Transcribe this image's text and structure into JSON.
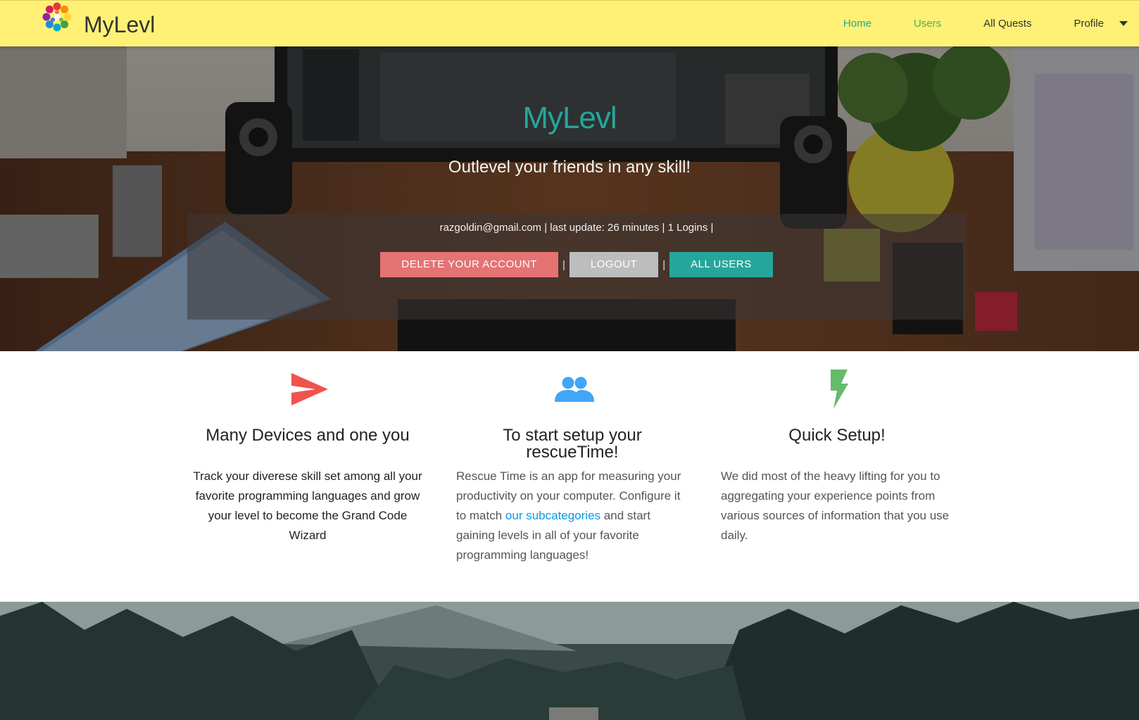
{
  "navbar": {
    "brand": "MyLevl",
    "links": [
      {
        "label": "Home"
      },
      {
        "label": "Users"
      },
      {
        "label": "All Quests"
      },
      {
        "label": "Profile"
      }
    ],
    "bg_color": "#fff176"
  },
  "hero": {
    "title": "MyLevl",
    "subtitle": "Outlevel your friends in any skill!",
    "info": "razgoldin@gmail.com | last update: 26 minutes | 1 Logins |",
    "buttons": {
      "delete": "Delete your account",
      "logout": "Logout",
      "all_users": "All users"
    },
    "separator": "|",
    "accent": "#26a69a"
  },
  "features": [
    {
      "icon": "send-icon",
      "icon_color": "#ef5350",
      "title": "Many Devices and one you",
      "text": "Track your diverese skill set among all your favorite programming languages and grow your level to become the Grand Code Wizard"
    },
    {
      "icon": "group-icon",
      "icon_color": "#42a5f5",
      "title": "To start setup your rescueTime!",
      "text_before": "Rescue Time is an app for measuring your productivity on your computer. Configure it to match ",
      "link": "our subcategories",
      "text_after": " and start gaining levels in all of your favorite programming languages!"
    },
    {
      "icon": "flash-icon",
      "icon_color": "#66bb6a",
      "title": "Quick Setup!",
      "text": "We did most of the heavy lifting for you to aggregating your experience points from various sources of information that you use daily."
    }
  ]
}
